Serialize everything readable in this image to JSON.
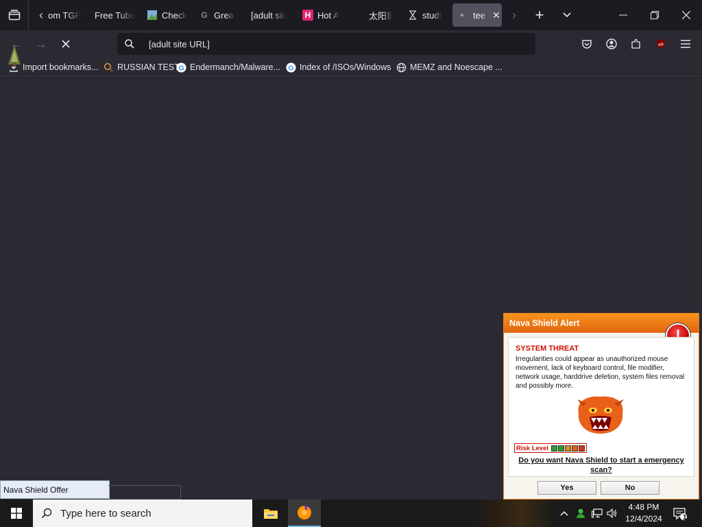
{
  "browser": {
    "tabs": [
      {
        "label": "om TGP",
        "favicon": "none"
      },
      {
        "label": "Free Tube",
        "favicon": "none"
      },
      {
        "label": "Check",
        "favicon": "image-icon"
      },
      {
        "label": "Great",
        "favicon": "g-icon"
      },
      {
        "label": "[adult site]",
        "favicon": "none"
      },
      {
        "label": "Hot A",
        "favicon": "h-icon"
      },
      {
        "label": "太阳影",
        "favicon": "none"
      },
      {
        "label": "studt",
        "favicon": "hourglass-icon"
      },
      {
        "label": "tee",
        "favicon": "loading-dot-icon",
        "active": true
      }
    ],
    "url": "[adult site URL]",
    "bookmarks": [
      {
        "label": "Import bookmarks...",
        "icon": "import-icon"
      },
      {
        "label": "RUSSIAN TEST",
        "icon": "magnifier-icon"
      },
      {
        "label": "Endermanch/Malware...",
        "icon": "google-icon"
      },
      {
        "label": "Index of /ISOs/Windows",
        "icon": "google-icon"
      },
      {
        "label": "MEMZ and Noescape ...",
        "icon": "globe-icon"
      }
    ],
    "status_text": "Nava Shield Offer"
  },
  "popup": {
    "title": "Nava Shield Alert",
    "threat_title": "SYSTEM THREAT",
    "threat_text": "Irregularities could appear as unauthorized mouse movement, lack of keyboard control, file modifier, network usage, harddrive deletion, system files removal and possibly more.",
    "risk_label": "Risk Level",
    "risk_colors": [
      "#2e9e2e",
      "#2e9e2e",
      "#e08a1a",
      "#e0641a",
      "#d9301a"
    ],
    "question": "Do you want Nava Shield to start a emergency scan?",
    "yes_label": "Yes",
    "no_label": "No",
    "accent": "#f7931e"
  },
  "taskbar": {
    "search_placeholder": "Type here to search",
    "time": "4:48 PM",
    "date": "12/4/2024",
    "notification_count": "1"
  },
  "colors": {
    "tab_bg": "#1c1b22",
    "toolbar_bg": "#2b2a33",
    "active_tab": "#52525e"
  }
}
